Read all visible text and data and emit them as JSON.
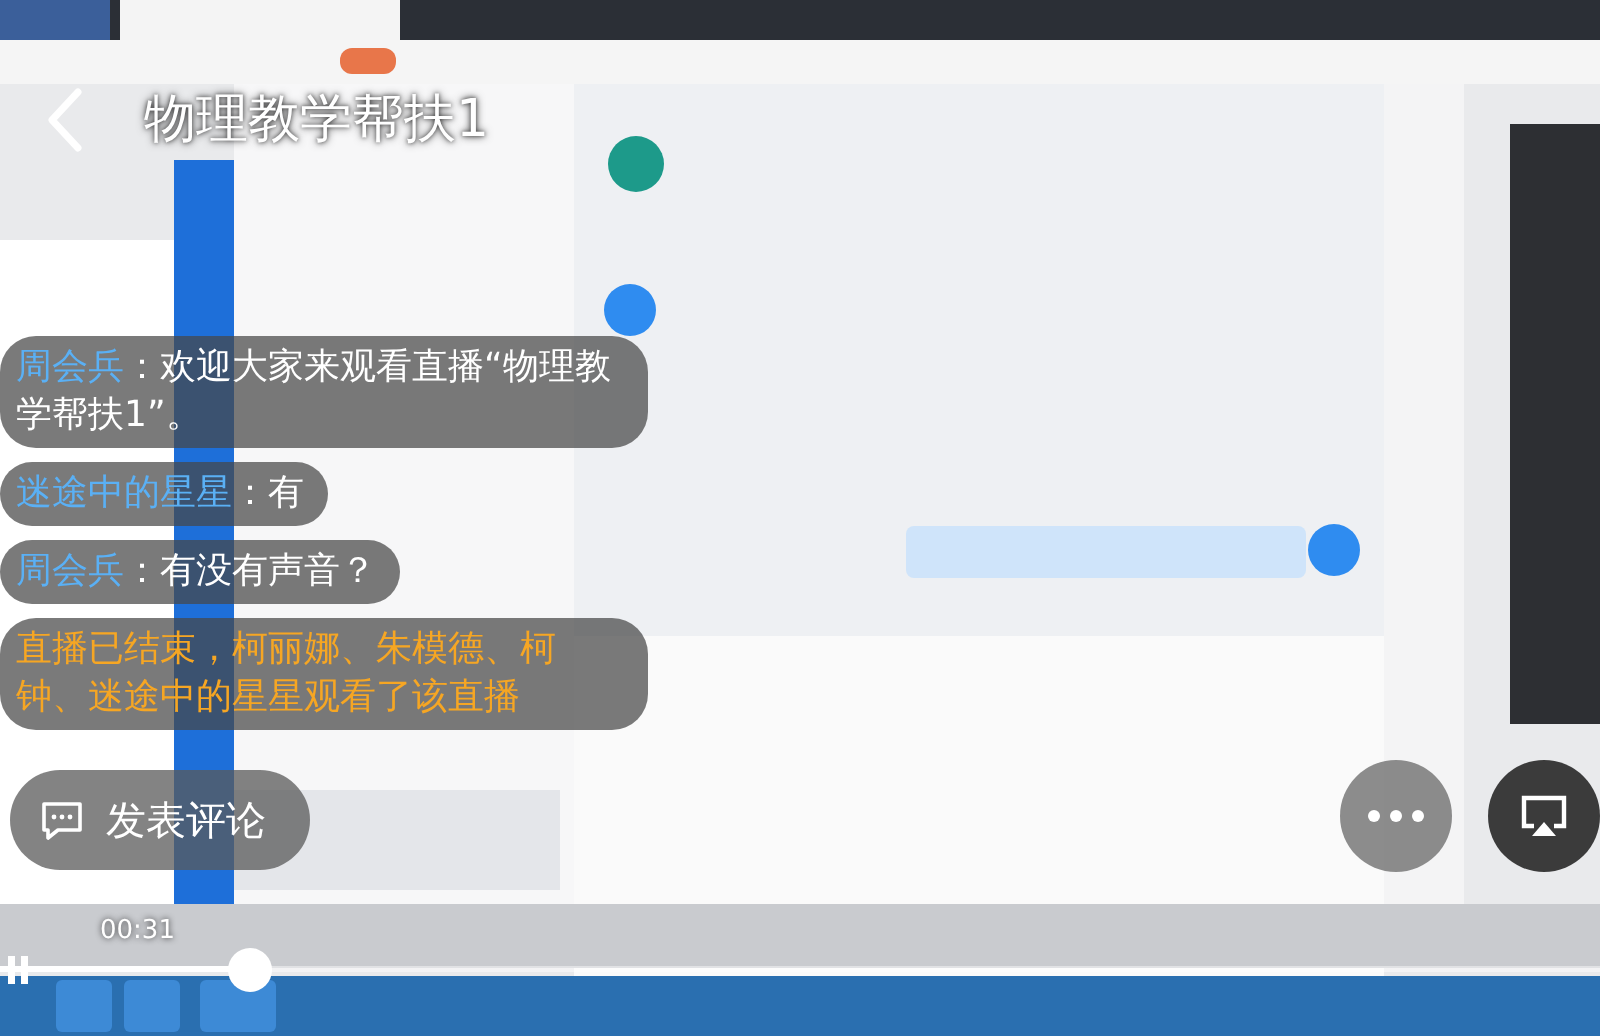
{
  "header": {
    "title": "物理教学帮扶1"
  },
  "comments": [
    {
      "kind": "user",
      "name": "周会兵",
      "text": "：欢迎大家来观看直播“物理教学帮扶1”。"
    },
    {
      "kind": "user",
      "name": "迷途中的星星",
      "text": "：有"
    },
    {
      "kind": "user",
      "name": "周会兵",
      "text": "：有没有声音？"
    },
    {
      "kind": "system",
      "text": "直播已结束，柯丽娜、朱模德、柯钟、迷途中的星星观看了该直播"
    }
  ],
  "comment_button": {
    "label": "发表评论"
  },
  "player": {
    "playing": true,
    "time": "00:31",
    "level": 0.156
  }
}
